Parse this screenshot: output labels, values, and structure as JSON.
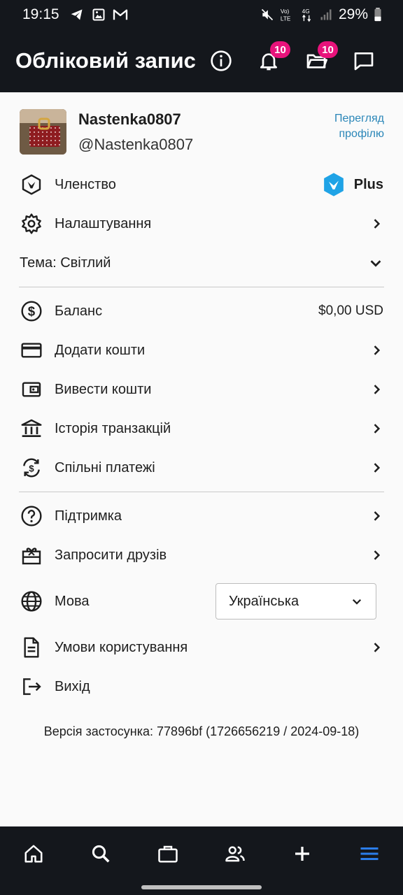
{
  "status_bar": {
    "time": "19:15",
    "network": "4G",
    "battery": "29%"
  },
  "header": {
    "title": "Обліковий запис",
    "notifications_count": "10",
    "projects_count": "10"
  },
  "profile": {
    "name": "Nastenka0807",
    "handle": "@Nastenka0807",
    "view_profile_line1": "Перегляд",
    "view_profile_line2": "профілю"
  },
  "menu": {
    "membership": "Членство",
    "membership_plan": "Plus",
    "settings": "Налаштування",
    "theme": "Тема: Світлий",
    "balance": "Баланс",
    "balance_value": "$0,00 USD",
    "add_funds": "Додати кошти",
    "withdraw": "Вивести кошти",
    "transactions": "Історія транзакцій",
    "shared_payments": "Спільні платежі",
    "support": "Підтримка",
    "invite": "Запросити друзів",
    "language": "Мова",
    "language_value": "Українська",
    "terms": "Умови користування",
    "logout": "Вихід"
  },
  "version": "Версія застосунка: 77896bf (1726656219 / 2024-09-18)",
  "colors": {
    "header_bg": "#14171c",
    "badge": "#e8137b",
    "link": "#2a86b8",
    "nav_active": "#2b7de9"
  },
  "bottom_nav": [
    "home-icon",
    "search-icon",
    "briefcase-icon",
    "people-icon",
    "plus-icon",
    "menu-icon"
  ]
}
